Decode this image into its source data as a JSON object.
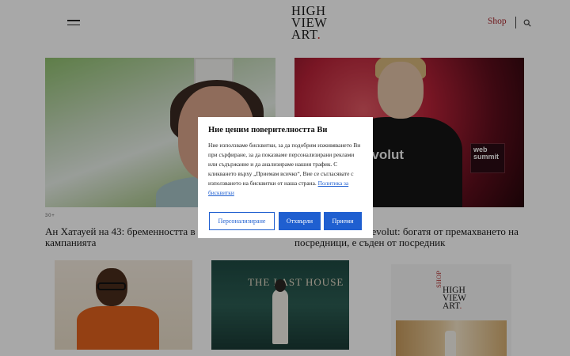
{
  "header": {
    "logo_lines": [
      "HIGH",
      "VIEW",
      "ART"
    ],
    "logo_dot": ".",
    "shop_label": "Shop"
  },
  "articles": [
    {
      "tag": "30+",
      "title": "Ан Хатауей на 43: бременността в центъра на кампанията"
    },
    {
      "tag": "",
      "title": "Основателят на Revolut: богатя от премахването на посредници, е съден от посредник"
    }
  ],
  "images": {
    "card2_shirt_text": "evolut",
    "card2_badge_text": "web summit",
    "card4_sign_text": "THE LAST HOUSE"
  },
  "ad": {
    "shop": "SHOP",
    "logo_lines": [
      "HIGH",
      "VIEW",
      "ART"
    ],
    "logo_dot": "."
  },
  "cookie_modal": {
    "title": "Ние ценим поверителността Ви",
    "body": "Ние използваме бисквитки, за да подобрим изживяването Ви при сърфиране, за да показваме персонализирани реклами или съдържание и да анализираме нашия трафик. С кликването върху „Приемам всичко“, Вие се съгласявате с използването на бисквитки от наша страна.",
    "policy_link": "Политика за бисквитки",
    "buttons": {
      "customize": "Персонализиране",
      "reject": "Отхвърли",
      "accept": "Приеми"
    }
  },
  "colors": {
    "accent_red": "#a8232a",
    "button_blue": "#1f5fd0",
    "overlay": "rgba(0,0,0,0.34)"
  },
  "icons": [
    "hamburger-menu-icon",
    "search-icon"
  ]
}
